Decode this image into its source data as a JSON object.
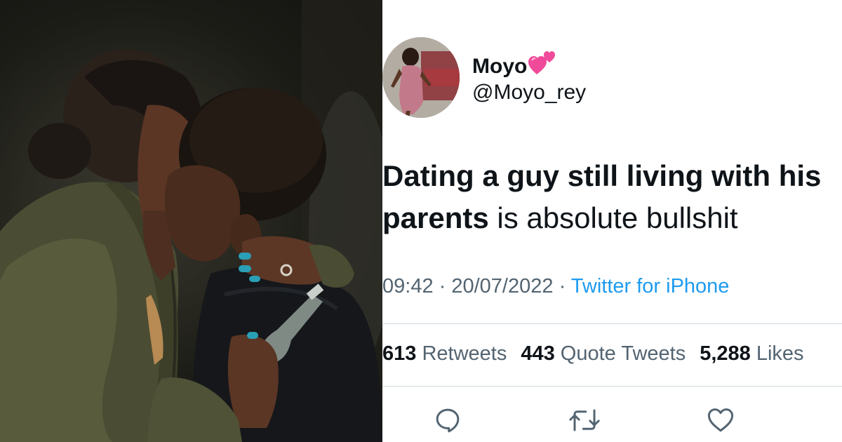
{
  "tweet": {
    "display_name": "Moyo",
    "handle": "@Moyo_rey",
    "text_bold": "Dating a guy still living with his parents",
    "text_line1": "Dating a guy still living with his",
    "text_line2_bold": "parents",
    "text_line2_rest": " is absolute bullshit",
    "time": "09:42",
    "separator": " · ",
    "date": "20/07/2022",
    "source": "Twitter for iPhone",
    "stats": {
      "retweets_count": "613",
      "retweets_label": "Retweets",
      "quotes_count": "443",
      "quotes_label": "Quote Tweets",
      "likes_count": "5,288",
      "likes_label": "Likes"
    },
    "name_emoji_icon": "two-hearts-icon",
    "actions": [
      "reply-icon",
      "retweet-icon",
      "like-icon"
    ]
  },
  "colors": {
    "text": "#0f1419",
    "secondary": "#536471",
    "link": "#1d9bf0",
    "divider": "#cfd9de",
    "heart": "#f04b9a"
  }
}
